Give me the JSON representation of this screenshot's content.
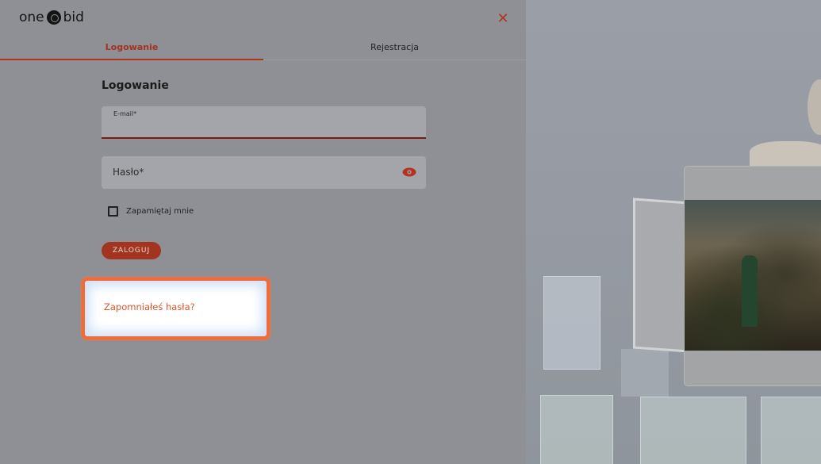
{
  "brand": {
    "logo_left": "one",
    "logo_right": "bid"
  },
  "icons": {
    "close": "close-icon",
    "eye": "eye-icon",
    "logo": "onebid-logo-mark"
  },
  "tabs": [
    {
      "label": "Logowanie",
      "active": true
    },
    {
      "label": "Rejestracja",
      "active": false
    }
  ],
  "form": {
    "title": "Logowanie",
    "email_label": "E-mail*",
    "email_value": "",
    "password_placeholder": "Hasło*",
    "remember_label": "Zapamiętaj mnie",
    "remember_checked": false,
    "submit_label": "ZALOGUJ",
    "forgot_label": "Zapomniałeś hasła?"
  },
  "colors": {
    "accent": "#b4321f",
    "highlight": "#f26a3a",
    "link": "#d9552a"
  }
}
